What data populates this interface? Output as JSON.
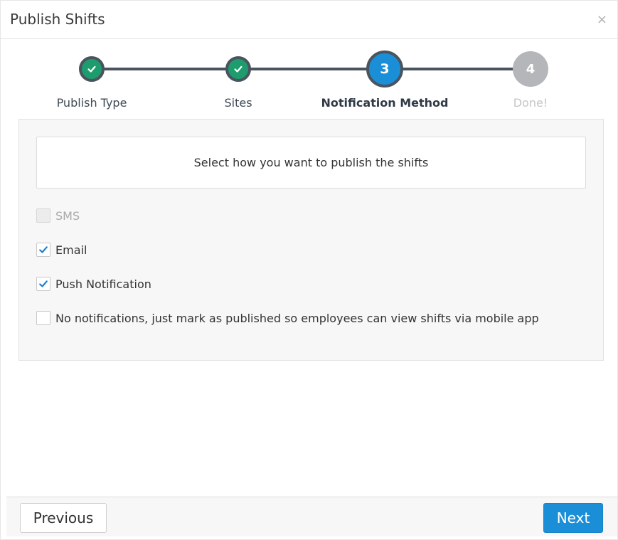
{
  "dialog": {
    "title": "Publish Shifts",
    "close_glyph": "×"
  },
  "stepper": {
    "steps": [
      {
        "label": "Publish Type",
        "state": "done",
        "icon": "check-icon"
      },
      {
        "label": "Sites",
        "state": "done",
        "icon": "check-icon"
      },
      {
        "label": "Notification Method",
        "state": "current",
        "number": "3"
      },
      {
        "label": "Done!",
        "state": "pending",
        "number": "4"
      }
    ]
  },
  "panel": {
    "instruction": "Select how you want to publish the shifts",
    "options": [
      {
        "label": "SMS",
        "checked": false,
        "disabled": true
      },
      {
        "label": "Email",
        "checked": true,
        "disabled": false
      },
      {
        "label": "Push Notification",
        "checked": true,
        "disabled": false
      },
      {
        "label": "No notifications, just mark as published so employees can view shifts via mobile app",
        "checked": false,
        "disabled": false
      }
    ]
  },
  "footer": {
    "previous_label": "Previous",
    "next_label": "Next"
  },
  "colors": {
    "accent": "#1a8fd8",
    "done": "#1d9c6e",
    "pending": "#b5b6ba",
    "track": "#4a545e"
  }
}
